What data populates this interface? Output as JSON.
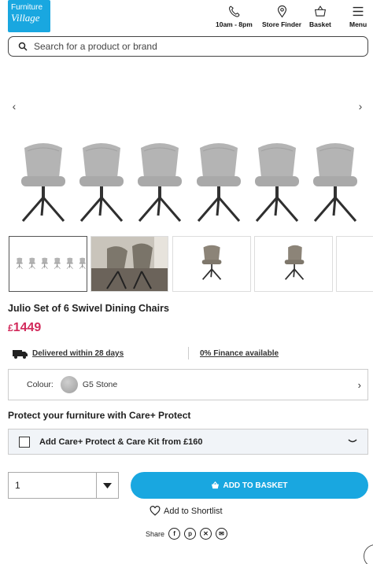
{
  "header": {
    "logo_line1": "Furniture",
    "logo_line2": "Village",
    "hours_label": "10am - 8pm",
    "store_finder_label": "Store Finder",
    "basket_label": "Basket",
    "menu_label": "Menu"
  },
  "search": {
    "placeholder": "Search for a product or brand"
  },
  "product": {
    "title": "Julio Set of 6 Swivel Dining Chairs",
    "price_currency": "£",
    "price_amount": "1449",
    "delivery_text": "Delivered within 28 days",
    "finance_text": "0% Finance available",
    "colour_label": "Colour:",
    "colour_value": "G5 Stone"
  },
  "protect": {
    "heading": "Protect your furniture with Care+ Protect",
    "option_label": "Add Care+ Protect & Care Kit from £160"
  },
  "purchase": {
    "quantity": "1",
    "add_to_basket_label": "ADD TO BASKET",
    "shortlist_label": "Add to Shortlist",
    "share_label": "Share"
  },
  "colors": {
    "brand_blue": "#19a7e0",
    "price_pink": "#d22a5b",
    "care_bg": "#f1f4f8"
  },
  "icons": [
    "phone-icon",
    "location-pin-icon",
    "basket-icon",
    "menu-icon",
    "search-icon",
    "chevron-left-icon",
    "chevron-right-icon",
    "delivery-truck-icon",
    "chevron-down-icon",
    "heart-icon",
    "facebook-icon",
    "pinterest-icon",
    "x-icon",
    "email-icon"
  ]
}
